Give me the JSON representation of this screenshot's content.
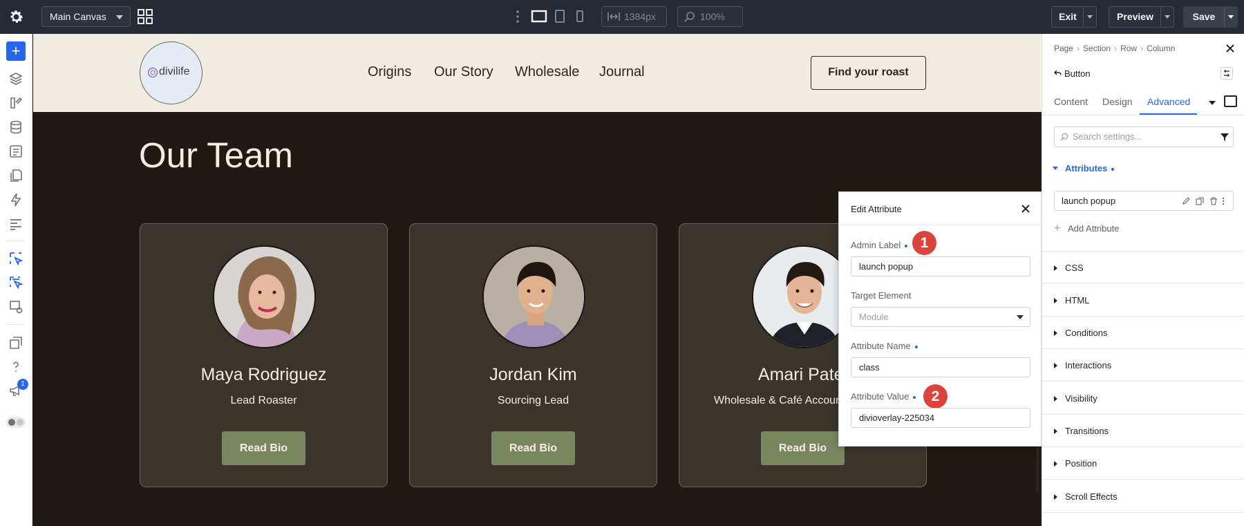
{
  "topbar": {
    "canvas_select": "Main Canvas",
    "width_value": "1384px",
    "zoom_value": "100%",
    "exit_label": "Exit",
    "preview_label": "Preview",
    "save_label": "Save"
  },
  "rail": {
    "notification_count": "1"
  },
  "site": {
    "logo_text": "divilife",
    "nav": [
      "Origins",
      "Our Story",
      "Wholesale",
      "Journal"
    ],
    "cta_label": "Find your roast",
    "section_title": "Our Team",
    "team": [
      {
        "name": "Maya Rodriguez",
        "role": "Lead Roaster",
        "button": "Read Bio"
      },
      {
        "name": "Jordan Kim",
        "role": "Sourcing Lead",
        "button": "Read Bio"
      },
      {
        "name": "Amari Patel",
        "role": "Wholesale & Café Account Manager",
        "button": "Read Bio"
      }
    ]
  },
  "modal": {
    "title": "Edit Attribute",
    "admin_label_label": "Admin Label",
    "admin_label_value": "launch popup",
    "target_element_label": "Target Element",
    "target_element_placeholder": "Module",
    "attribute_name_label": "Attribute Name",
    "attribute_name_value": "class",
    "attribute_value_label": "Attribute Value",
    "attribute_value_value": "divioverlay-225034",
    "markers": [
      "1",
      "2"
    ]
  },
  "panel": {
    "breadcrumb": [
      "Page",
      "Section",
      "Row",
      "Column"
    ],
    "module_name": "Button",
    "tabs": [
      "Content",
      "Design",
      "Advanced"
    ],
    "active_tab": "Advanced",
    "search_placeholder": "Search settings...",
    "attributes_section": "Attributes",
    "attribute_item": "launch popup",
    "add_attribute_label": "Add Attribute",
    "sections": [
      "CSS",
      "HTML",
      "Conditions",
      "Interactions",
      "Visibility",
      "Transitions",
      "Position",
      "Scroll Effects"
    ]
  },
  "colors": {
    "accent": "#2667e9",
    "topbar": "#262b33",
    "site_dark": "#201a14",
    "header_cream": "#f2ede2",
    "button_olive": "#7a8662",
    "marker_red": "#d9443c"
  }
}
